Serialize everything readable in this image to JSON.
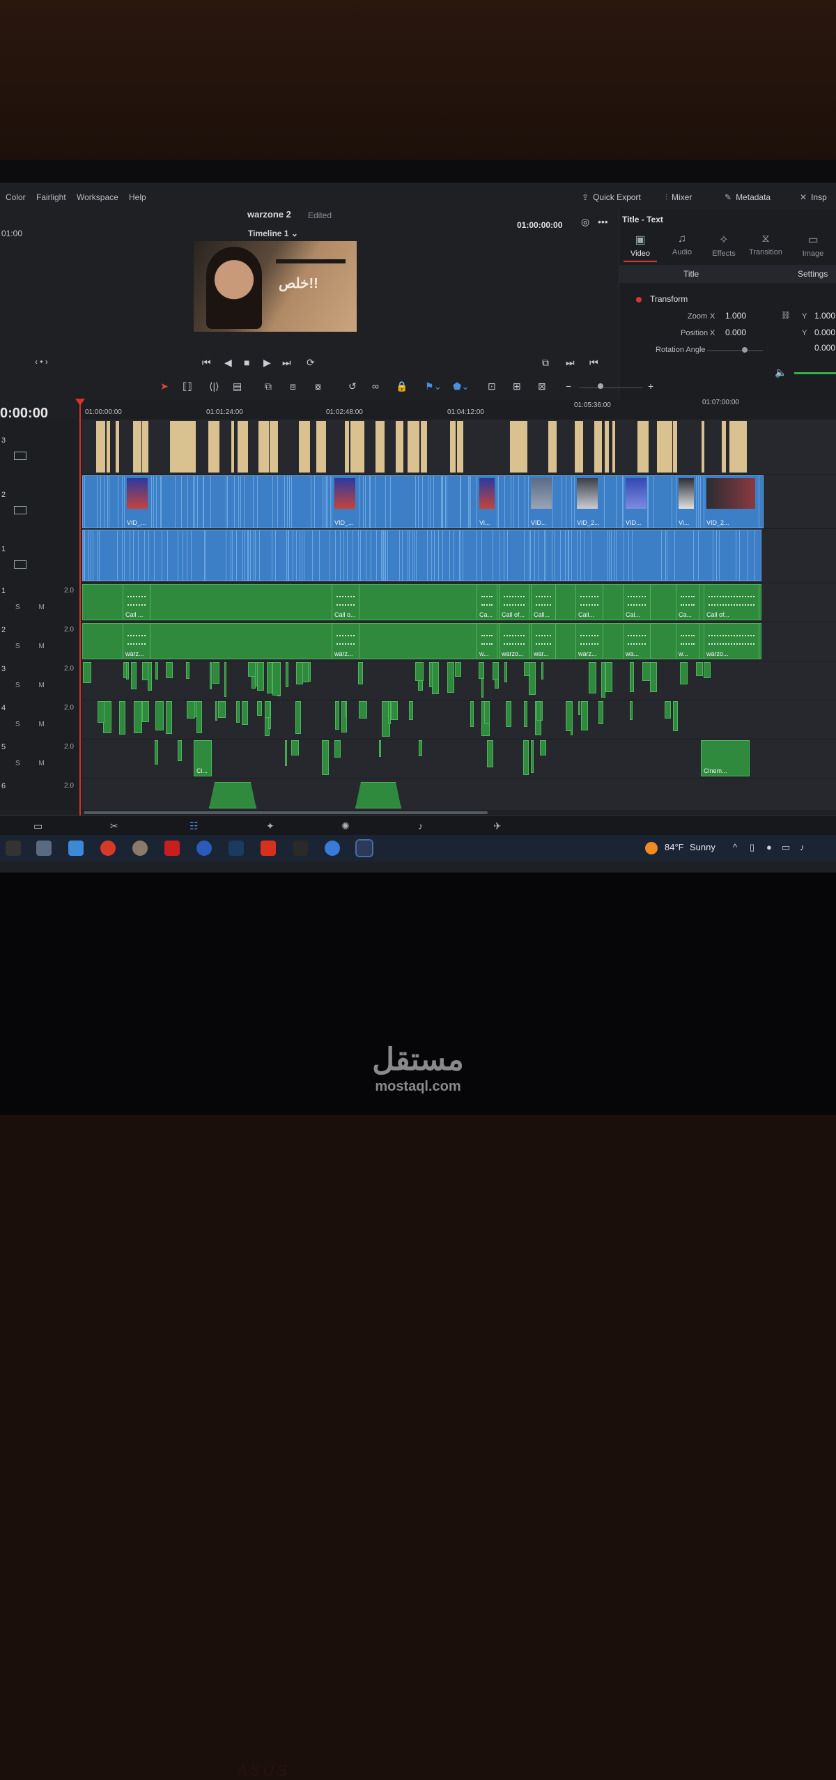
{
  "menu": [
    "Color",
    "Fairlight",
    "Workspace",
    "Help"
  ],
  "header": {
    "project_name": "warzone 2",
    "project_status": "Edited",
    "timeline_name": "Timeline 1",
    "left_timecode": "01:00",
    "viewer_timecode": "01:00:00:00",
    "quick_export": "Quick Export",
    "mixer": "Mixer",
    "metadata": "Metadata",
    "inspector": "Insp"
  },
  "viewer": {
    "overlay_text": "خلص!!"
  },
  "inspector": {
    "title": "Title - Text",
    "tabs": [
      "Video",
      "Audio",
      "Effects",
      "Transition",
      "Image"
    ],
    "subtabs": [
      "Title",
      "Settings"
    ],
    "section": "Transform",
    "zoom_label": "Zoom",
    "zoom_x": "1.000",
    "zoom_y": "1.000",
    "position_label": "Position",
    "position_x": "0.000",
    "position_y": "0.000",
    "rotation_label": "Rotation Angle",
    "rotation_value": "0.000",
    "x_label": "X",
    "y_label": "Y"
  },
  "timeline": {
    "current_timecode": "0:00:00",
    "ruler": [
      "01:00:00:00",
      "01:01:24:00",
      "01:02:48:00",
      "01:04:12:00",
      "01:05:36:00",
      "01:07:00:00"
    ],
    "video_tracks": [
      "3",
      "2",
      "1"
    ],
    "audio_tracks": [
      {
        "num": "1",
        "level": "2.0"
      },
      {
        "num": "2",
        "level": "2.0"
      },
      {
        "num": "3",
        "level": "2.0"
      },
      {
        "num": "4",
        "level": "2.0"
      },
      {
        "num": "5",
        "level": "2.0"
      },
      {
        "num": "6",
        "level": "2.0"
      }
    ],
    "solo_mute": "S M",
    "v2_labels": [
      "VID_...",
      "VID_...",
      "Vi...",
      "VID...",
      "VID_2...",
      "VID...",
      "Vi...",
      "VID_2..."
    ],
    "a1_labels": [
      "Call ...",
      "Call o...",
      "Ca...",
      "Call of...",
      "Call...",
      "Call...",
      "Cal...",
      "Ca...",
      "Call of..."
    ],
    "a2_labels": [
      "warz...",
      "warz...",
      "w...",
      "warzo...",
      "war...",
      "warz...",
      "wa...",
      "w...",
      "warzo..."
    ],
    "a5_labels": [
      "Ci...",
      "Cinem..."
    ]
  },
  "taskbar": {
    "temperature": "84°F",
    "condition": "Sunny"
  },
  "watermark": {
    "arabic": "مستقل",
    "latin": "mostaql.com"
  },
  "colors": {
    "video_clip": "#3c7fc6",
    "title_clip": "#d9c28f",
    "audio_clip": "#2f8a3d",
    "playhead": "#d4342a"
  }
}
